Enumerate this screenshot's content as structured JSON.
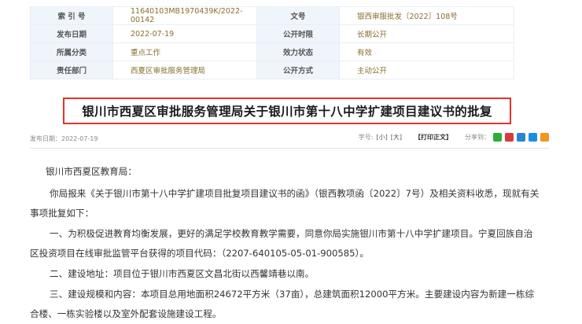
{
  "meta": {
    "rows": [
      {
        "k1": "索 引 号",
        "v1": "11640103MB1970439K/2022-00142",
        "k2": "文号",
        "v2": "银西审服批发〔2022〕108号"
      },
      {
        "k1": "发布日期",
        "v1": "2022-07-19",
        "k2": "公开时限",
        "v2": "长期公开"
      },
      {
        "k1": "所属分类",
        "v1": "重点工作",
        "k2": "效力状态",
        "v2": "有效"
      },
      {
        "k1": "责任部门",
        "v1": "西夏区审批服务管理局",
        "k2": "公开方式",
        "v2": "主动公开"
      }
    ]
  },
  "article": {
    "title": "银川市西夏区审批服务管理局关于银川市第十八中学扩建项目建议书的批复",
    "publish_label": "发布日期：2022-07-19",
    "font_size_label": "字号:",
    "font_small": "[小]",
    "font_large": "[大]",
    "print_label": "【打印正文】",
    "share_label": "分享到：",
    "share_icons": [
      {
        "name": "wechat-icon",
        "color": "#2bad3a"
      },
      {
        "name": "weibo-icon",
        "color": "#d83b3b"
      },
      {
        "name": "qzone-icon",
        "color": "#2a84d6"
      },
      {
        "name": "qq-icon",
        "color": "#1c8ee0"
      },
      {
        "name": "more-share-icon",
        "color": "#f0961e"
      }
    ],
    "paragraphs": [
      "银川市西夏区教育局：",
      "你局报来《关于银川市第十八中学扩建项目批复项目建议书的函》（银西教项函〔2022〕7号）及相关资料收悉，现就有关事项批复如下：",
      "一、为积极促进教育均衡发展，更好的满足学校教育教学需要，同意你局实施银川市第十八中学扩建项目。宁夏回族自治区投资项目在线审批监管平台获得的项目代码：（2207-640105-05-01-900585）。",
      "二、建设地址：项目位于银川市西夏区文昌北街以西馨靖巷以南。",
      "三、建设规模和内容：本项目总用地面积24672平方米（37亩），总建筑面积12000平方米。主要建设内容为新建一栋综合楼、一栋实验楼以及室外配套设施建设工程。"
    ]
  }
}
